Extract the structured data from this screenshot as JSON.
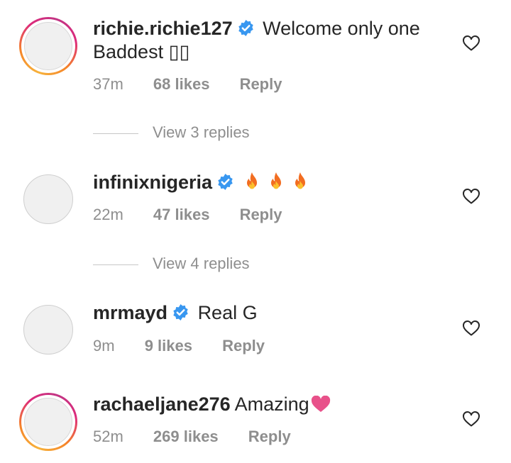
{
  "comments": [
    {
      "username": "richie.richie127",
      "text_line1": "Welcome only one",
      "text_line2": "Baddest",
      "broken_glyphs": "▯▯",
      "time": "37m",
      "likes": "68 likes",
      "reply": "Reply",
      "view_replies": "View 3 replies"
    },
    {
      "username": "infinixnigeria",
      "text": "",
      "emoji": "fire-icon x3",
      "time": "22m",
      "likes": "47 likes",
      "reply": "Reply",
      "view_replies": "View 4 replies"
    },
    {
      "username": "mrmayd",
      "text": "Real G",
      "time": "9m",
      "likes": "9 likes",
      "reply": "Reply"
    },
    {
      "username": "rachaeljane276",
      "text": "Amazing",
      "emoji": "heart-icon",
      "time": "52m",
      "likes": "269 likes",
      "reply": "Reply"
    }
  ],
  "colors": {
    "verified": "#3897f0",
    "meta_text": "#8e8e8e",
    "fire": "#f26d21",
    "heart_emoji": "#e8518a"
  }
}
